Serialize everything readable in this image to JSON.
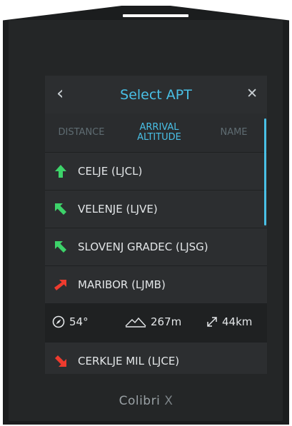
{
  "header": {
    "back_icon": "chevron-left-icon",
    "title": "Select APT",
    "close_icon": "close-icon"
  },
  "tabs": [
    {
      "label": "DISTANCE",
      "active": false
    },
    {
      "label_line1": "ARRIVAL",
      "label_line2": "ALTITUDE",
      "active": true
    },
    {
      "label": "NAME",
      "active": false
    }
  ],
  "airports": [
    {
      "label": "CELJE (LJCL)",
      "arrow_color": "#3dd36a",
      "arrow": "up-arrow-icon"
    },
    {
      "label": "VELENJE (LJVE)",
      "arrow_color": "#3dd36a",
      "arrow": "up-left-arrow-icon"
    },
    {
      "label": "SLOVENJ GRADEC (LJSG)",
      "arrow_color": "#3dd36a",
      "arrow": "up-left-arrow-icon"
    },
    {
      "label": "MARIBOR (LJMB)",
      "arrow_color": "#ee3b2e",
      "arrow": "up-right-arrow-icon"
    },
    {
      "label": "CERKLJE MIL (LJCE)",
      "arrow_color": "#ee3b2e",
      "arrow": "down-right-arrow-icon"
    }
  ],
  "info": {
    "heading": "54°",
    "altitude": "267m",
    "distance": "44km"
  },
  "brand": {
    "name": "Colibri",
    "suffix": " X"
  },
  "colors": {
    "accent": "#49c0e6",
    "positive": "#3dd36a",
    "negative": "#ee3b2e"
  }
}
